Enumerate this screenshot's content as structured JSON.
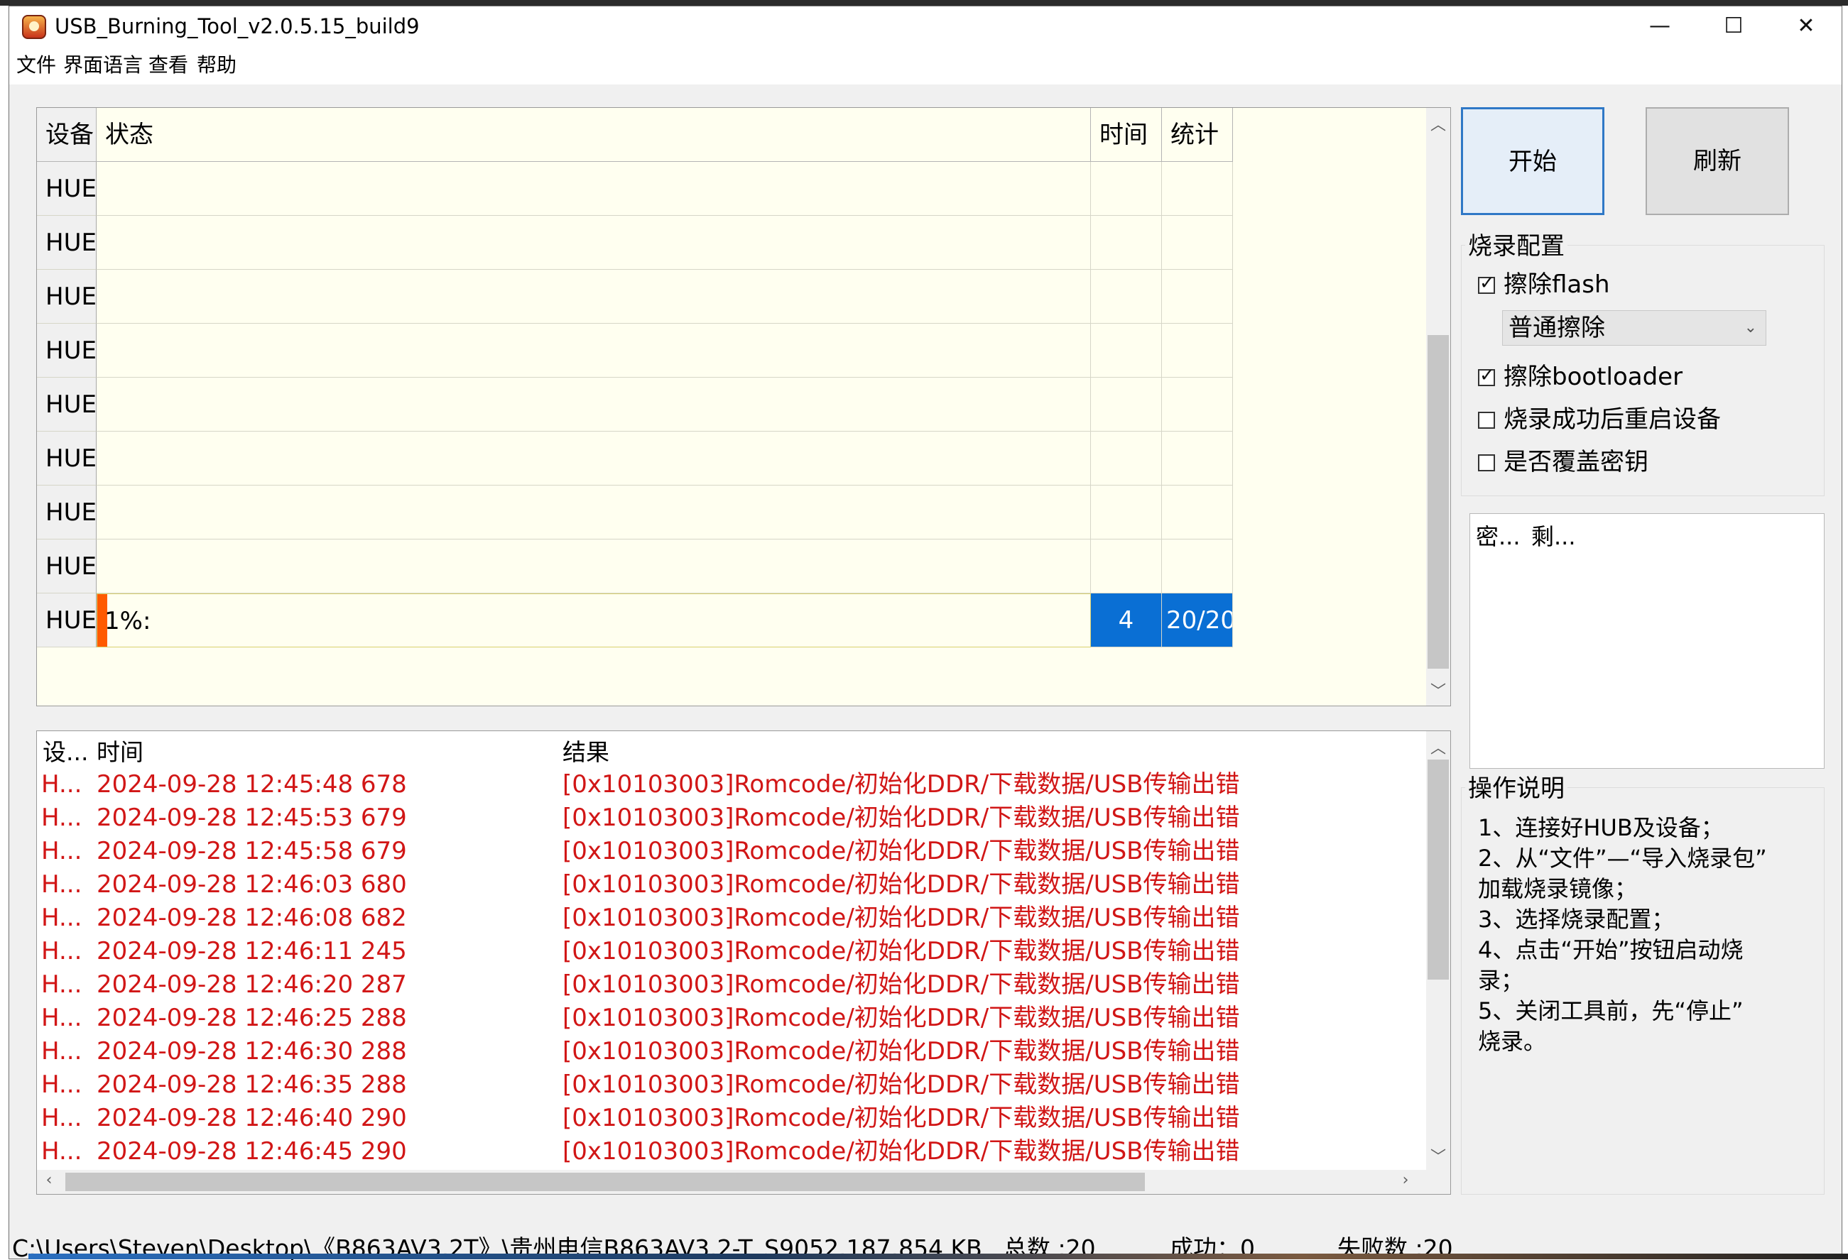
{
  "window": {
    "title": "USB_Burning_Tool_v2.0.5.15_build9",
    "controls": {
      "minimize": "—",
      "maximize": "☐",
      "close": "✕"
    }
  },
  "menu": [
    "文件",
    "界面语言",
    "查看",
    "帮助"
  ],
  "device_table": {
    "headers": {
      "device": "设备",
      "status": "状态",
      "time": "时间",
      "stats": "统计"
    },
    "rows": [
      {
        "device": "HUE",
        "status": "",
        "time": "",
        "stats": ""
      },
      {
        "device": "HUE",
        "status": "",
        "time": "",
        "stats": ""
      },
      {
        "device": "HUE",
        "status": "",
        "time": "",
        "stats": ""
      },
      {
        "device": "HUE",
        "status": "",
        "time": "",
        "stats": ""
      },
      {
        "device": "HUE",
        "status": "",
        "time": "",
        "stats": ""
      },
      {
        "device": "HUE",
        "status": "",
        "time": "",
        "stats": ""
      },
      {
        "device": "HUE",
        "status": "",
        "time": "",
        "stats": ""
      },
      {
        "device": "HUE",
        "status": "",
        "time": "",
        "stats": ""
      }
    ],
    "active_row": {
      "device": "HUE",
      "status": "1%:",
      "progress_percent": 1,
      "time": "4",
      "stats": "20/20"
    }
  },
  "buttons": {
    "start": "开始",
    "refresh": "刷新"
  },
  "burn_config": {
    "title": "烧录配置",
    "erase_flash": {
      "label": "擦除flash",
      "checked": true
    },
    "erase_mode": {
      "selected": "普通擦除"
    },
    "erase_bootloader": {
      "label": "擦除bootloader",
      "checked": true
    },
    "reboot_after": {
      "label": "烧录成功后重启设备",
      "checked": false
    },
    "overwrite_key": {
      "label": "是否覆盖密钥",
      "checked": false
    }
  },
  "key_list": {
    "col1": "密...",
    "col2": "剩..."
  },
  "help": {
    "title": "操作说明",
    "lines": [
      "1、连接好HUB及设备；",
      "2、从“文件”—“导入烧录包”",
      "加载烧录镜像；",
      "3、选择烧录配置；",
      "4、点击“开始”按钮启动烧",
      "录；",
      "5、关闭工具前，先“停止”",
      "烧录。"
    ]
  },
  "log_table": {
    "headers": {
      "device": "设...",
      "time": "时间",
      "result": "结果"
    },
    "rows": [
      {
        "device": "H...",
        "time": "2024-09-28 12:45:48 678",
        "result": "[0x10103003]Romcode/初始化DDR/下载数据/USB传输出错"
      },
      {
        "device": "H...",
        "time": "2024-09-28 12:45:53 679",
        "result": "[0x10103003]Romcode/初始化DDR/下载数据/USB传输出错"
      },
      {
        "device": "H...",
        "time": "2024-09-28 12:45:58 679",
        "result": "[0x10103003]Romcode/初始化DDR/下载数据/USB传输出错"
      },
      {
        "device": "H...",
        "time": "2024-09-28 12:46:03 680",
        "result": "[0x10103003]Romcode/初始化DDR/下载数据/USB传输出错"
      },
      {
        "device": "H...",
        "time": "2024-09-28 12:46:08 682",
        "result": "[0x10103003]Romcode/初始化DDR/下载数据/USB传输出错"
      },
      {
        "device": "H...",
        "time": "2024-09-28 12:46:11 245",
        "result": "[0x10103003]Romcode/初始化DDR/下载数据/USB传输出错"
      },
      {
        "device": "H...",
        "time": "2024-09-28 12:46:20 287",
        "result": "[0x10103003]Romcode/初始化DDR/下载数据/USB传输出错"
      },
      {
        "device": "H...",
        "time": "2024-09-28 12:46:25 288",
        "result": "[0x10103003]Romcode/初始化DDR/下载数据/USB传输出错"
      },
      {
        "device": "H...",
        "time": "2024-09-28 12:46:30 288",
        "result": "[0x10103003]Romcode/初始化DDR/下载数据/USB传输出错"
      },
      {
        "device": "H...",
        "time": "2024-09-28 12:46:35 288",
        "result": "[0x10103003]Romcode/初始化DDR/下载数据/USB传输出错"
      },
      {
        "device": "H...",
        "time": "2024-09-28 12:46:40 290",
        "result": "[0x10103003]Romcode/初始化DDR/下载数据/USB传输出错"
      },
      {
        "device": "H...",
        "time": "2024-09-28 12:46:45 290",
        "result": "[0x10103003]Romcode/初始化DDR/下载数据/USB传输出错"
      }
    ]
  },
  "status_bar": {
    "path": "C:\\Users\\Steven\\Desktop\\《B863AV3.2T》\\贵州电信B863AV3.2-T_S9052.187.854 KB",
    "total": "总数 :20",
    "success": "成功：0",
    "fail": "失败数 :20"
  },
  "colors": {
    "table_bg": "#fffff0",
    "selection_blue": "#0a6fd4",
    "progress_orange": "#ff5a00",
    "error_red": "#d11616",
    "primary_border": "#2f78c6"
  }
}
